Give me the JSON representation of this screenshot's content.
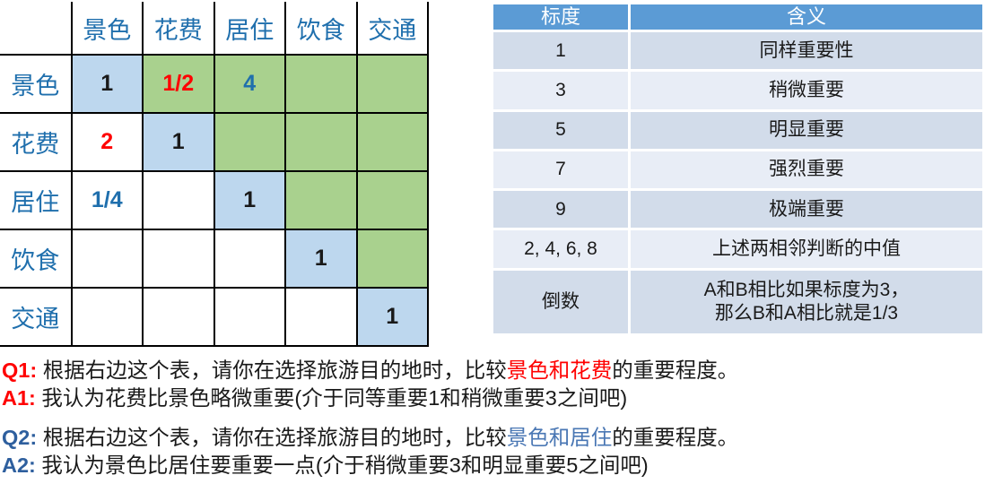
{
  "matrix": {
    "corner_label": "",
    "criteria": [
      "景色",
      "花费",
      "居住",
      "饮食",
      "交通"
    ],
    "column_headers": [
      "景色",
      "花费",
      "居住",
      "饮食",
      "交通"
    ],
    "row_headers": [
      "景色",
      "花费",
      "居住",
      "饮食",
      "交通"
    ],
    "cells": [
      [
        {
          "value": "1",
          "fill": "diag",
          "color": "black"
        },
        {
          "value": "1/2",
          "fill": "upper",
          "color": "red"
        },
        {
          "value": "4",
          "fill": "upper",
          "color": "blue"
        },
        {
          "value": "",
          "fill": "upper",
          "color": "black"
        },
        {
          "value": "",
          "fill": "upper",
          "color": "black"
        }
      ],
      [
        {
          "value": "2",
          "fill": "lower",
          "color": "red"
        },
        {
          "value": "1",
          "fill": "diag",
          "color": "black"
        },
        {
          "value": "",
          "fill": "upper",
          "color": "black"
        },
        {
          "value": "",
          "fill": "upper",
          "color": "black"
        },
        {
          "value": "",
          "fill": "upper",
          "color": "black"
        }
      ],
      [
        {
          "value": "1/4",
          "fill": "lower",
          "color": "blue"
        },
        {
          "value": "",
          "fill": "lower",
          "color": "black"
        },
        {
          "value": "1",
          "fill": "diag",
          "color": "black"
        },
        {
          "value": "",
          "fill": "upper",
          "color": "black"
        },
        {
          "value": "",
          "fill": "upper",
          "color": "black"
        }
      ],
      [
        {
          "value": "",
          "fill": "lower",
          "color": "black"
        },
        {
          "value": "",
          "fill": "lower",
          "color": "black"
        },
        {
          "value": "",
          "fill": "lower",
          "color": "black"
        },
        {
          "value": "1",
          "fill": "diag",
          "color": "black"
        },
        {
          "value": "",
          "fill": "upper",
          "color": "black"
        }
      ],
      [
        {
          "value": "",
          "fill": "lower",
          "color": "black"
        },
        {
          "value": "",
          "fill": "lower",
          "color": "black"
        },
        {
          "value": "",
          "fill": "lower",
          "color": "black"
        },
        {
          "value": "",
          "fill": "lower",
          "color": "black"
        },
        {
          "value": "1",
          "fill": "diag",
          "color": "black"
        }
      ]
    ]
  },
  "scale_table": {
    "headers": [
      "标度",
      "含义"
    ],
    "rows": [
      {
        "scale": "1",
        "meaning": "同样重要性"
      },
      {
        "scale": "3",
        "meaning": "稍微重要"
      },
      {
        "scale": "5",
        "meaning": "明显重要"
      },
      {
        "scale": "7",
        "meaning": "强烈重要"
      },
      {
        "scale": "9",
        "meaning": "极端重要"
      },
      {
        "scale": "2, 4, 6, 8",
        "meaning": "上述两相邻判断的中值"
      },
      {
        "scale": "倒数",
        "meaning_line1": "A和B相比如果标度为3，",
        "meaning_line2": "那么B和A相比就是1/3"
      }
    ]
  },
  "qa": {
    "q1": {
      "tag": "Q1:",
      "text_before": " 根据右边这个表，请你在选择旅游目的地时，比较",
      "highlight": "景色和花费",
      "text_after": "的重要程度。"
    },
    "a1": {
      "tag": "A1:",
      "text": " 我认为花费比景色略微重要(介于同等重要1和稍微重要3之间吧)"
    },
    "q2": {
      "tag": "Q2:",
      "text_before": " 根据右边这个表，请你在选择旅游目的地时，比较",
      "highlight": "景色和居住",
      "text_after": "的重要程度。"
    },
    "a2": {
      "tag": "A2:",
      "text": " 我认为景色比居住要重要一点(介于稍微重要3和明显重要5之间吧)"
    }
  },
  "colors": {
    "diag_fill": "#bdd7ee",
    "upper_fill": "#a9d18e",
    "header_blue": "#5b9bd5",
    "row_shade_dark": "#d2dcea",
    "row_shade_light": "#e8edf6",
    "accent_blue": "#1f6fad",
    "accent_red": "#ff0000",
    "tag_blue": "#2e5f9e"
  }
}
